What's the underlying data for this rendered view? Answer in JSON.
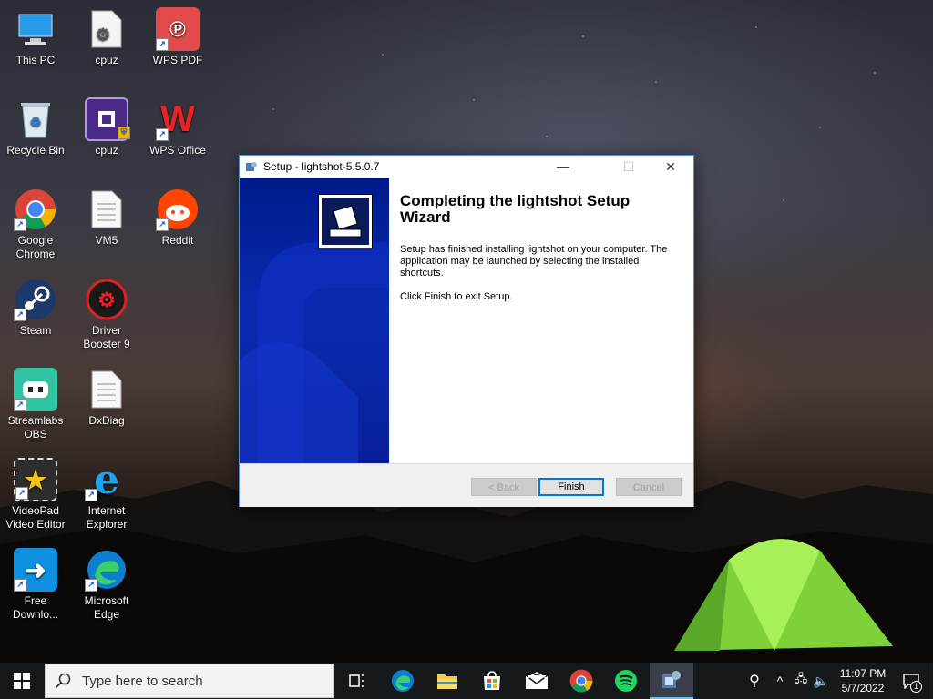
{
  "desktop": {
    "icons": [
      {
        "label": "This PC",
        "icon": "computer-icon"
      },
      {
        "label": "cpuz",
        "icon": "gear-file-icon"
      },
      {
        "label": "WPS PDF",
        "icon": "wps-pdf-icon"
      },
      {
        "label": "Recycle Bin",
        "icon": "recycle-bin-icon"
      },
      {
        "label": "cpuz",
        "icon": "cpuz-icon"
      },
      {
        "label": "WPS Office",
        "icon": "wps-office-icon"
      },
      {
        "label": "Google Chrome",
        "icon": "chrome-icon"
      },
      {
        "label": "VM5",
        "icon": "text-file-icon"
      },
      {
        "label": "Reddit",
        "icon": "reddit-icon"
      },
      {
        "label": "Steam",
        "icon": "steam-icon"
      },
      {
        "label": "Driver Booster 9",
        "icon": "driver-booster-icon"
      },
      {
        "label": "Streamlabs OBS",
        "icon": "streamlabs-icon"
      },
      {
        "label": "DxDiag",
        "icon": "text-file-icon"
      },
      {
        "label": "VideoPad Video Editor",
        "icon": "videopad-icon"
      },
      {
        "label": "Internet Explorer",
        "icon": "ie-icon"
      },
      {
        "label": "Free Downlo...",
        "icon": "free-download-icon"
      },
      {
        "label": "Microsoft Edge",
        "icon": "edge-icon"
      }
    ]
  },
  "window": {
    "title": "Setup - lightshot-5.5.0.7",
    "heading": "Completing the lightshot Setup Wizard",
    "body1": "Setup has finished installing lightshot on your computer. The application may be launched by selecting the installed shortcuts.",
    "body2": "Click Finish to exit Setup.",
    "back_label": "< Back",
    "finish_label": "Finish",
    "cancel_label": "Cancel",
    "minimize_glyph": "—",
    "maximize_glyph": "☐",
    "close_glyph": "✕"
  },
  "taskbar": {
    "search_placeholder": "Type here to search",
    "time": "11:07 PM",
    "date": "5/7/2022",
    "notification_count": "1"
  }
}
